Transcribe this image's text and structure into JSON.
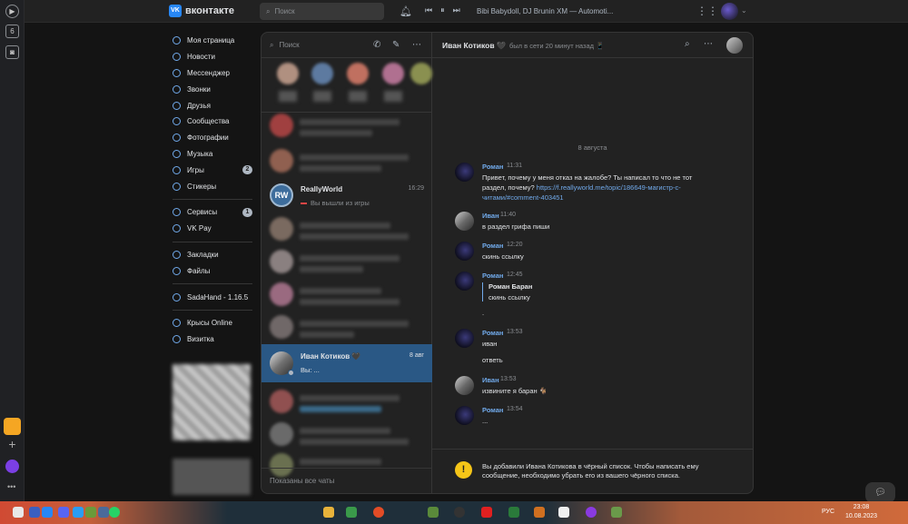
{
  "rail": {
    "badge_number": "6"
  },
  "topbar": {
    "logo_mark": "VK",
    "logo_text": "вконтакте",
    "search_placeholder": "Поиск",
    "track": "Bibi Babydoll, DJ Brunin XM — Automoti..."
  },
  "nav": {
    "items": [
      {
        "label": "Моя страница"
      },
      {
        "label": "Новости"
      },
      {
        "label": "Мессенджер"
      },
      {
        "label": "Звонки"
      },
      {
        "label": "Друзья"
      },
      {
        "label": "Сообщества"
      },
      {
        "label": "Фотографии"
      },
      {
        "label": "Музыка"
      },
      {
        "label": "Игры",
        "badge": "2"
      },
      {
        "label": "Стикеры"
      }
    ],
    "services": [
      {
        "label": "Сервисы",
        "badge": "1"
      },
      {
        "label": "VK Pay"
      }
    ],
    "extra": [
      {
        "label": "Закладки"
      },
      {
        "label": "Файлы"
      }
    ],
    "apps": [
      {
        "label": "SadaHand - 1.16.5"
      }
    ],
    "games": [
      {
        "label": "Крысы Online"
      },
      {
        "label": "Визитка"
      }
    ]
  },
  "chatlist": {
    "search_placeholder": "Поиск",
    "reallyworld": {
      "avatar": "RW",
      "name": "ReallyWorld",
      "time": "16:29",
      "message": "Вы вышли из игры"
    },
    "active": {
      "name": "Иван Котиков 🖤",
      "time": "8 авг",
      "message": "Вы: ..."
    },
    "footer": "Показаны все чаты"
  },
  "conversation": {
    "name": "Иван Котиков 🖤",
    "status": "был в сети 20 минут назад 📱",
    "date": "8 августа",
    "messages": [
      {
        "author": "Роман",
        "time": "11:31",
        "text": "Привет, почему у меня отказ на жалобе? Ты написал то что не тот раздел, почему?",
        "link": "https://f.reallyworld.me/topic/186649-магистр-с-читами/#comment-403451"
      },
      {
        "author": "Иван",
        "time": "11:40",
        "text": "в раздел грифа пиши"
      },
      {
        "author": "Роман",
        "time": "12:20",
        "text": "скинь ссылку"
      },
      {
        "author": "Роман",
        "time": "12:45",
        "quote_name": "Роман Баран",
        "quote_text": "скинь ссылку",
        "after": "."
      },
      {
        "author": "Роман",
        "time": "13:53",
        "text": "иван",
        "after": "ответь"
      },
      {
        "author": "Иван",
        "time": "13:53",
        "text": "извините я баран 🐐"
      },
      {
        "author": "Роман",
        "time": "13:54",
        "text": "..."
      }
    ],
    "blacklist_notice": "Вы добавили Ивана Котикова в чёрный список. Чтобы написать ему сообщение, необходимо убрать его из вашего чёрного списка.",
    "warn_mark": "!"
  },
  "taskbar": {
    "lang": "РУС",
    "time": "23:08",
    "date": "10.08.2023"
  }
}
